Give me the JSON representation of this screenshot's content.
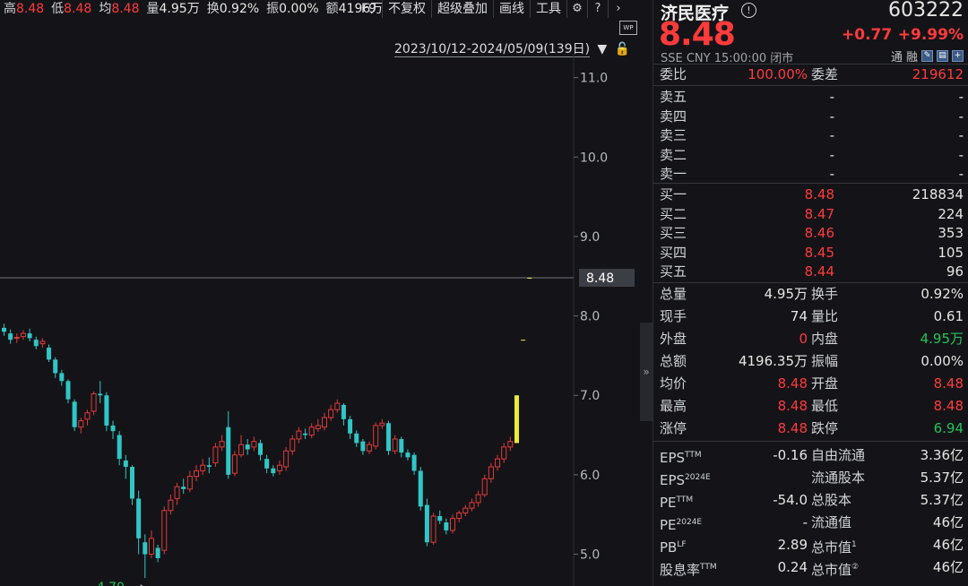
{
  "header": {
    "stats": [
      {
        "label": "高",
        "value": "8.48",
        "color": "red"
      },
      {
        "label": "低",
        "value": "8.48",
        "color": "red"
      },
      {
        "label": "均",
        "value": "8.48",
        "color": "red"
      },
      {
        "label": "量",
        "value": "4.95万",
        "color": "white"
      },
      {
        "label": "换",
        "value": "0.92%",
        "color": "white"
      },
      {
        "label": "振",
        "value": "0.00%",
        "color": "white"
      },
      {
        "label": "额",
        "value": "4196万",
        "color": "white"
      }
    ],
    "toolbar": [
      "F9",
      "不复权",
      "超级叠加",
      "画线",
      "工具"
    ],
    "toolbar_icons": [
      "gear-icon",
      "help-icon",
      "chevron-right-icon"
    ],
    "range": "2023/10/12-2024/05/09(139日)",
    "wp_badge": "WP"
  },
  "chart_data": {
    "type": "candlestick",
    "y_axis_ticks": [
      "11.0",
      "10.0",
      "9.0",
      "8.0",
      "7.0",
      "6.0",
      "5.0"
    ],
    "ylim": [
      4.6,
      11.3
    ],
    "last_price_label": "8.48",
    "min_annotation": "4.70",
    "colors": {
      "up": "#e03a3a",
      "down": "#31c6c6",
      "limit": "#e8ea3c",
      "grid": "#2a2d33"
    },
    "candles": [
      [
        7.85,
        7.8,
        7.9,
        7.75
      ],
      [
        7.78,
        7.7,
        7.83,
        7.65
      ],
      [
        7.72,
        7.73,
        7.78,
        7.66
      ],
      [
        7.74,
        7.78,
        7.82,
        7.7
      ],
      [
        7.78,
        7.72,
        7.84,
        7.68
      ],
      [
        7.7,
        7.62,
        7.74,
        7.58
      ],
      [
        7.65,
        7.68,
        7.72,
        7.6
      ],
      [
        7.6,
        7.45,
        7.64,
        7.42
      ],
      [
        7.45,
        7.28,
        7.48,
        7.22
      ],
      [
        7.28,
        7.18,
        7.32,
        7.12
      ],
      [
        7.18,
        6.95,
        7.2,
        6.9
      ],
      [
        6.92,
        6.6,
        6.95,
        6.55
      ],
      [
        6.6,
        6.68,
        6.72,
        6.52
      ],
      [
        6.7,
        6.78,
        6.82,
        6.62
      ],
      [
        6.8,
        7.02,
        7.05,
        6.75
      ],
      [
        7.02,
        7.0,
        7.18,
        6.9
      ],
      [
        7.0,
        6.62,
        7.04,
        6.55
      ],
      [
        6.62,
        6.55,
        6.68,
        6.45
      ],
      [
        6.5,
        6.2,
        6.55,
        6.12
      ],
      [
        6.18,
        6.1,
        6.25,
        5.95
      ],
      [
        6.1,
        5.7,
        6.12,
        5.62
      ],
      [
        5.7,
        5.2,
        5.8,
        5.0
      ],
      [
        5.15,
        5.0,
        5.25,
        4.7
      ],
      [
        5.0,
        5.2,
        5.3,
        4.95
      ],
      [
        5.08,
        4.95,
        5.12,
        4.9
      ],
      [
        5.05,
        5.55,
        5.6,
        5.0
      ],
      [
        5.55,
        5.68,
        5.75,
        5.5
      ],
      [
        5.7,
        5.85,
        5.9,
        5.62
      ],
      [
        5.85,
        5.82,
        5.95,
        5.76
      ],
      [
        5.82,
        5.98,
        6.05,
        5.78
      ],
      [
        5.98,
        6.05,
        6.12,
        5.92
      ],
      [
        6.05,
        6.12,
        6.2,
        6.0
      ],
      [
        6.12,
        6.1,
        6.22,
        6.02
      ],
      [
        6.15,
        6.35,
        6.4,
        6.1
      ],
      [
        6.35,
        6.42,
        6.5,
        6.3
      ],
      [
        6.6,
        6.0,
        6.8,
        5.95
      ],
      [
        6.02,
        6.25,
        6.3,
        5.98
      ],
      [
        6.25,
        6.38,
        6.5,
        6.22
      ],
      [
        6.38,
        6.32,
        6.45,
        6.25
      ],
      [
        6.35,
        6.42,
        6.48,
        6.3
      ],
      [
        6.4,
        6.25,
        6.44,
        6.18
      ],
      [
        6.2,
        6.08,
        6.25,
        6.02
      ],
      [
        6.08,
        6.02,
        6.12,
        5.98
      ],
      [
        6.05,
        6.12,
        6.18,
        6.0
      ],
      [
        6.1,
        6.3,
        6.35,
        6.05
      ],
      [
        6.3,
        6.45,
        6.5,
        6.25
      ],
      [
        6.45,
        6.55,
        6.6,
        6.4
      ],
      [
        6.52,
        6.5,
        6.58,
        6.45
      ],
      [
        6.5,
        6.6,
        6.65,
        6.46
      ],
      [
        6.58,
        6.62,
        6.7,
        6.54
      ],
      [
        6.6,
        6.72,
        6.78,
        6.56
      ],
      [
        6.72,
        6.82,
        6.88,
        6.68
      ],
      [
        6.82,
        6.9,
        6.95,
        6.78
      ],
      [
        6.88,
        6.7,
        6.9,
        6.62
      ],
      [
        6.7,
        6.52,
        6.74,
        6.45
      ],
      [
        6.52,
        6.4,
        6.56,
        6.35
      ],
      [
        6.42,
        6.3,
        6.45,
        6.25
      ],
      [
        6.3,
        6.38,
        6.42,
        6.26
      ],
      [
        6.36,
        6.62,
        6.66,
        6.32
      ],
      [
        6.62,
        6.65,
        6.7,
        6.58
      ],
      [
        6.65,
        6.3,
        6.68,
        6.25
      ],
      [
        6.3,
        6.45,
        6.5,
        6.26
      ],
      [
        6.45,
        6.28,
        6.48,
        6.22
      ],
      [
        6.28,
        6.22,
        6.32,
        6.18
      ],
      [
        6.25,
        6.05,
        6.28,
        6.0
      ],
      [
        6.05,
        5.6,
        6.1,
        5.55
      ],
      [
        5.62,
        5.15,
        5.7,
        5.1
      ],
      [
        5.15,
        5.48,
        5.52,
        5.12
      ],
      [
        5.48,
        5.42,
        5.55,
        5.38
      ],
      [
        5.4,
        5.3,
        5.45,
        5.25
      ],
      [
        5.3,
        5.45,
        5.5,
        5.26
      ],
      [
        5.45,
        5.52,
        5.55,
        5.4
      ],
      [
        5.52,
        5.58,
        5.62,
        5.48
      ],
      [
        5.58,
        5.65,
        5.7,
        5.54
      ],
      [
        5.65,
        5.75,
        5.8,
        5.6
      ],
      [
        5.75,
        5.95,
        6.0,
        5.72
      ],
      [
        5.95,
        6.1,
        6.15,
        5.9
      ],
      [
        6.1,
        6.2,
        6.25,
        6.05
      ],
      [
        6.2,
        6.35,
        6.4,
        6.15
      ],
      [
        6.35,
        6.42,
        6.48,
        6.3
      ],
      [
        6.4,
        7.0,
        7.0,
        6.4
      ],
      [
        7.7,
        7.7,
        7.7,
        7.7
      ],
      [
        8.48,
        8.48,
        8.48,
        8.48
      ]
    ]
  },
  "quote": {
    "name": "济民医疗",
    "info_icon": "info-icon",
    "code": "603222",
    "last": "8.48",
    "change_abs": "+0.77",
    "change_pct": "+9.99%",
    "meta": "SSE  CNY  15:00:00  闭市",
    "tags": [
      "通",
      "融"
    ],
    "tag_icons": [
      "edit-icon",
      "layout-icon",
      "add-icon"
    ],
    "ratio": {
      "label1": "委比",
      "val1": "100.00%",
      "label2": "委差",
      "val2": "219612"
    },
    "asks": [
      {
        "label": "卖五",
        "price": "-",
        "vol": "-"
      },
      {
        "label": "卖四",
        "price": "-",
        "vol": "-"
      },
      {
        "label": "卖三",
        "price": "-",
        "vol": "-"
      },
      {
        "label": "卖二",
        "price": "-",
        "vol": "-"
      },
      {
        "label": "卖一",
        "price": "-",
        "vol": "-"
      }
    ],
    "bids": [
      {
        "label": "买一",
        "price": "8.48",
        "vol": "218834"
      },
      {
        "label": "买二",
        "price": "8.47",
        "vol": "224"
      },
      {
        "label": "买三",
        "price": "8.46",
        "vol": "353"
      },
      {
        "label": "买四",
        "price": "8.45",
        "vol": "105"
      },
      {
        "label": "买五",
        "price": "8.44",
        "vol": "96"
      }
    ],
    "stats": [
      {
        "l1": "总量",
        "v1": "4.95万",
        "c1": "white",
        "l2": "换手",
        "v2": "0.92%",
        "c2": "white"
      },
      {
        "l1": "现手",
        "v1": "74",
        "c1": "white",
        "l2": "量比",
        "v2": "0.61",
        "c2": "white"
      },
      {
        "l1": "外盘",
        "v1": "0",
        "c1": "red",
        "l2": "内盘",
        "v2": "4.95万",
        "c2": "green"
      },
      {
        "l1": "总额",
        "v1": "4196.35万",
        "c1": "white",
        "l2": "振幅",
        "v2": "0.00%",
        "c2": "white"
      },
      {
        "l1": "均价",
        "v1": "8.48",
        "c1": "red",
        "l2": "开盘",
        "v2": "8.48",
        "c2": "red"
      },
      {
        "l1": "最高",
        "v1": "8.48",
        "c1": "red",
        "l2": "最低",
        "v2": "8.48",
        "c2": "red"
      },
      {
        "l1": "涨停",
        "v1": "8.48",
        "c1": "red",
        "l2": "跌停",
        "v2": "6.94",
        "c2": "green"
      }
    ],
    "fundamentals": [
      {
        "l1": "EPS",
        "s1": "TTM",
        "v1": "-0.16",
        "l2": "自由流通",
        "v2": "3.36亿"
      },
      {
        "l1": "EPS",
        "s1": "2024E",
        "v1": "",
        "l2": "流通股本",
        "v2": "5.37亿"
      },
      {
        "l1": "PE",
        "s1": "TTM",
        "v1": "-54.0",
        "l2": "总股本",
        "v2": "5.37亿"
      },
      {
        "l1": "PE",
        "s1": "2024E",
        "v1": "-",
        "l2": "流通值",
        "v2": "46亿"
      },
      {
        "l1": "PB",
        "s1": "LF",
        "v1": "2.89",
        "l2": "总市值",
        "s2": "1",
        "v2": "46亿"
      },
      {
        "l1": "股息率",
        "s1": "TTM",
        "v1": "0.24",
        "l2": "总市值",
        "s2": "②",
        "v2": "46亿"
      }
    ]
  }
}
